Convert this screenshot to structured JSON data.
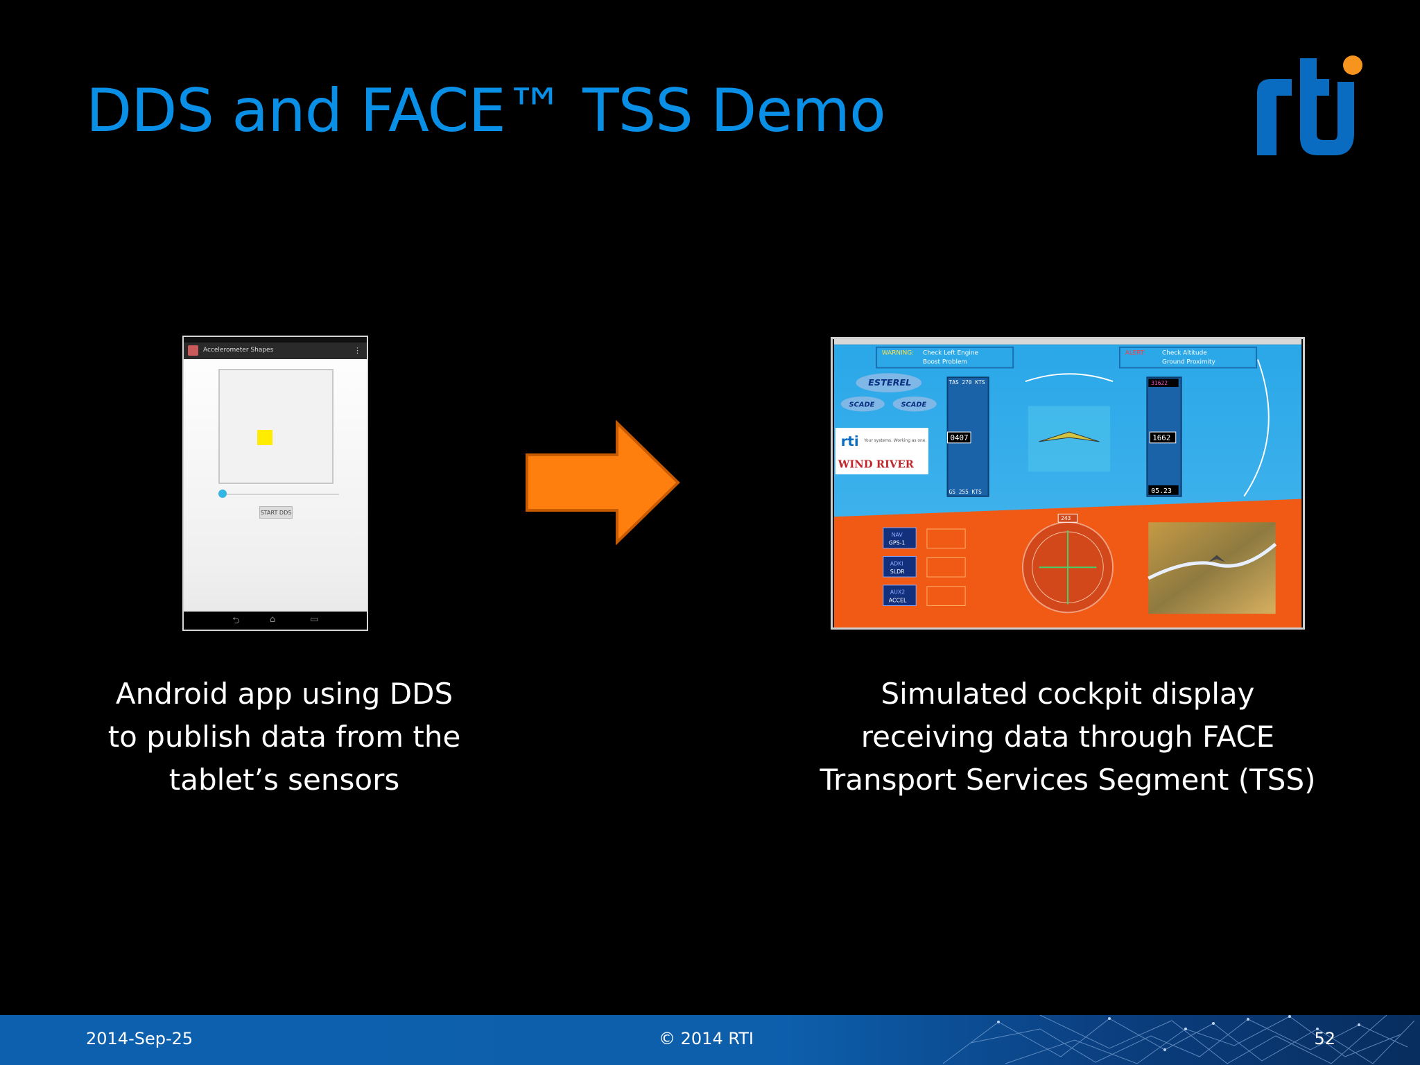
{
  "slide": {
    "title": "DDS and FACE™ TSS Demo",
    "logo_text": "rti",
    "colors": {
      "title": "#0a8fe6",
      "logo_blue": "#0a6cc1",
      "logo_dot": "#f7941d",
      "arrow": "#ff7f0e",
      "footer": "#0d60ad"
    }
  },
  "android_app": {
    "app_title": "Accelerometer Shapes",
    "start_button": "START DDS"
  },
  "cockpit": {
    "warning_label": "WARNING:",
    "warning_text_1": "Check Left Engine",
    "warning_text_2": "Boost Problem",
    "alert_label": "ALERT:",
    "alert_text_1": "Check Altitude",
    "alert_text_2": "Ground Proximity",
    "esterel": "ESTEREL",
    "scade_1": "SCADE",
    "scade_2": "SCADE",
    "rti_tag": "Your systems. Working as one.",
    "wind_river": "WIND RIVER",
    "speed_top": "TAS 270 KTS",
    "speed_current": "0407",
    "speed_bottom": "GS 255 KTS",
    "alt_top": "31622",
    "alt_current": "1662",
    "alt_bottom": "05.23",
    "heading": "243",
    "buttons": [
      "NAV",
      "ADKI",
      "AUX2"
    ],
    "button_sub": [
      "GPS-1",
      "SLDR",
      "ACCEL"
    ]
  },
  "captions": {
    "left_1": "Android app using DDS",
    "left_2": "to publish data from the",
    "left_3": "tablet’s sensors",
    "right_1": "Simulated cockpit display",
    "right_2": "receiving data through FACE",
    "right_3": "Transport Services Segment (TSS)"
  },
  "footer": {
    "date": "2014-Sep-25",
    "copyright": "© 2014 RTI",
    "page": "52"
  }
}
